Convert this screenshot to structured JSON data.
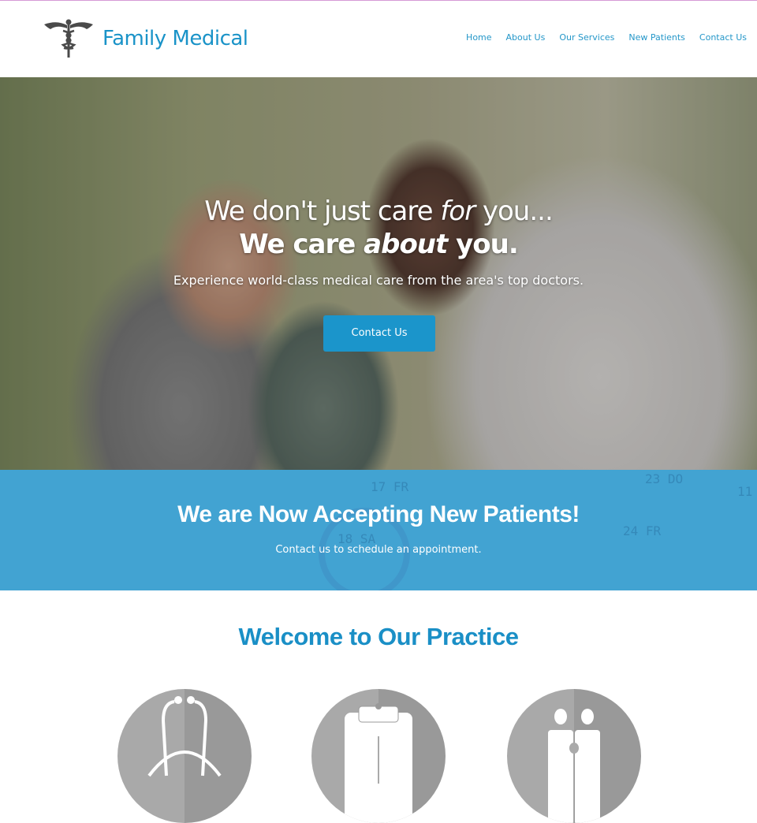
{
  "header": {
    "logo_icon": "caduceus-icon",
    "brand": "Family Medical",
    "nav": [
      {
        "label": "Home"
      },
      {
        "label": "About Us"
      },
      {
        "label": "Our Services"
      },
      {
        "label": "New Patients"
      },
      {
        "label": "Contact Us"
      }
    ]
  },
  "hero": {
    "line1_pre": "We don't just care ",
    "line1_em": "for",
    "line1_post": " you...",
    "line2_pre": "We care ",
    "line2_em": "about",
    "line2_post": " you.",
    "subtitle": "Experience world-class medical care from the area's top doctors.",
    "cta_label": "Contact Us"
  },
  "banner": {
    "title": "We are Now Accepting New Patients!",
    "subtitle": "Contact us to schedule an appointment.",
    "calendar_marks": [
      "17 FR",
      "23 DO",
      "18 SA",
      "24 FR",
      "11"
    ]
  },
  "welcome": {
    "title": "Welcome to Our Practice",
    "icons": [
      "stethoscope-icon",
      "clipboard-icon",
      "family-icon"
    ]
  },
  "colors": {
    "accent": "#1a93c8",
    "button": "#1b95cb",
    "banner": "#42a3d2",
    "icon_circle": "#a9a9a9"
  }
}
